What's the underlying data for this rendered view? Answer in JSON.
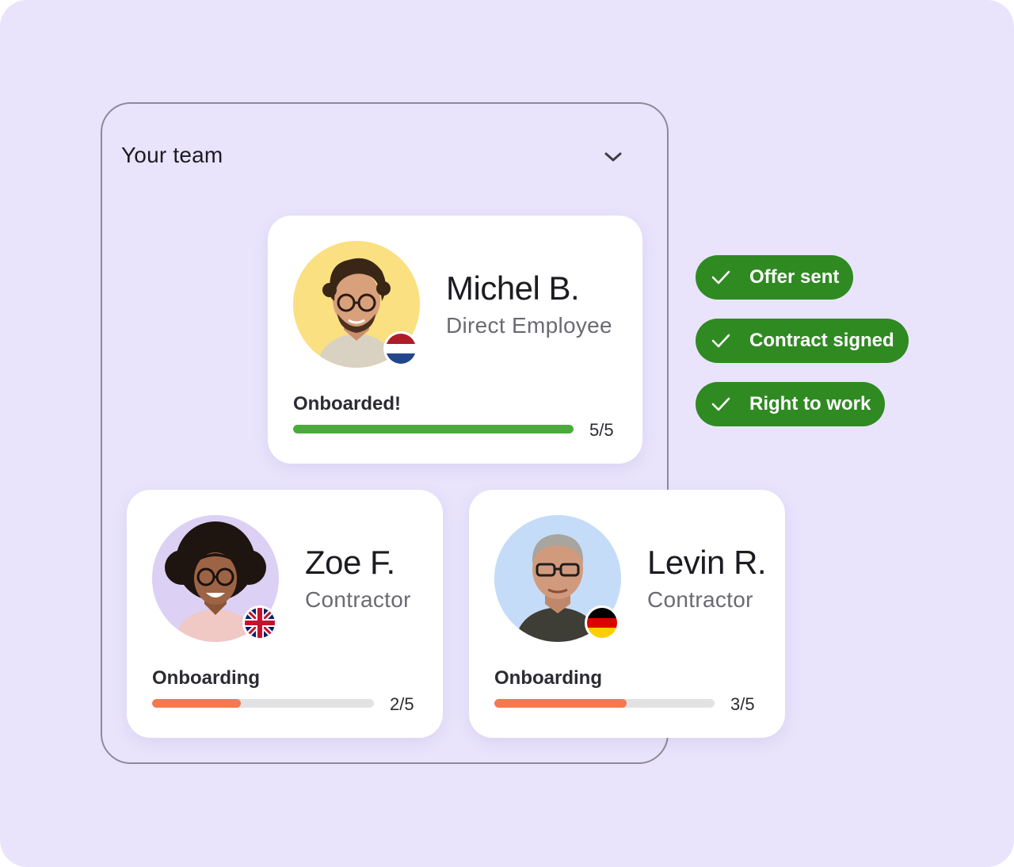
{
  "team": {
    "title": "Your team"
  },
  "members": [
    {
      "name": "Michel B.",
      "role": "Direct Employee",
      "status": "Onboarded!",
      "progress_label": "5/5",
      "progress_fraction": 1.0,
      "progress_color": "#4caa3c",
      "avatar_bg": "#fae080",
      "flag": "netherlands-flag-icon"
    },
    {
      "name": "Zoe F.",
      "role": "Contractor",
      "status": "Onboarding",
      "progress_label": "2/5",
      "progress_fraction": 0.4,
      "progress_color": "#f47a4e",
      "avatar_bg": "#dcd0f5",
      "flag": "united-kingdom-flag-icon"
    },
    {
      "name": "Levin R.",
      "role": "Contractor",
      "status": "Onboarding",
      "progress_label": "3/5",
      "progress_fraction": 0.6,
      "progress_color": "#f47a4e",
      "avatar_bg": "#c4dcf8",
      "flag": "germany-flag-icon"
    }
  ],
  "checklist": [
    {
      "label": "Offer sent",
      "icon": "check-icon"
    },
    {
      "label": "Contract signed",
      "icon": "check-icon"
    },
    {
      "label": "Right to work",
      "icon": "check-icon"
    }
  ],
  "colors": {
    "background": "#e9e4fc",
    "pill_green": "#2f8a22",
    "complete_green": "#4caa3c",
    "in_progress_orange": "#f47a4e"
  }
}
